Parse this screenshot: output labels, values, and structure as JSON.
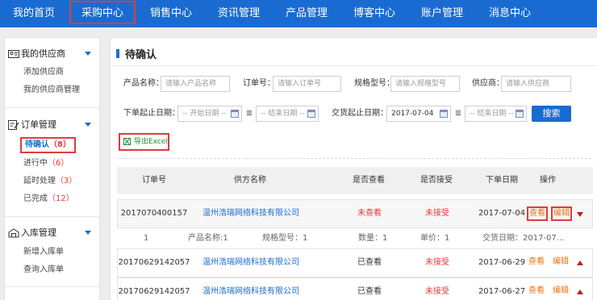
{
  "nav": {
    "items": [
      {
        "label": "我的首页"
      },
      {
        "label": "采购中心"
      },
      {
        "label": "销售中心"
      },
      {
        "label": "资讯管理"
      },
      {
        "label": "产品管理"
      },
      {
        "label": "博客中心"
      },
      {
        "label": "账户管理"
      },
      {
        "label": "消息中心"
      }
    ],
    "active_index": 1
  },
  "sidebar": {
    "suppliers": {
      "title": "我的供应商",
      "items": [
        {
          "label": "添加供应商"
        },
        {
          "label": "我的供应商管理"
        }
      ]
    },
    "orders": {
      "title": "订单管理",
      "items": [
        {
          "label": "待确认",
          "count": "（8）"
        },
        {
          "label": "进行中",
          "count": "（6）"
        },
        {
          "label": "延时处理",
          "count": "（3）"
        },
        {
          "label": "已完成",
          "count": "（12）"
        }
      ]
    },
    "warehouse": {
      "title": "入库管理",
      "items": [
        {
          "label": "新增入库单"
        },
        {
          "label": "查询入库单"
        }
      ]
    }
  },
  "main": {
    "title": "待确认",
    "filters": {
      "product_label": "产品名称：",
      "product_placeholder": "请输入产品名称",
      "order_label": "订单号：",
      "order_placeholder": "请输入订单号",
      "spec_label": "规格型号：",
      "spec_placeholder": "请输入规格型号",
      "supplier_label": "供应商：",
      "supplier_placeholder": "请输入供应商",
      "order_date_label": "下单起止日期：",
      "start_placeholder": "-- 开始日期 --",
      "end_placeholder": "-- 结束日期 --",
      "delivery_date_label": "交货起止日期：",
      "delivery_start_value": "2017-07-04",
      "delivery_end_placeholder": "-- 结束日期 --",
      "sort_icon": "≣",
      "search_label": "搜索"
    },
    "export_label": "导出Excel",
    "table": {
      "headers": [
        "订单号",
        "供方名称",
        "是否查看",
        "是否接受",
        "下单日期",
        "操作"
      ],
      "rows": [
        {
          "order_no": "20170704001​57",
          "supplier": "温州浩瑞网络科技有限公司",
          "viewed": "未查看",
          "accepted": "未接受",
          "date": "2017-07-04",
          "view": "查看",
          "edit": "编辑"
        },
        {
          "order_no": "20170629142057",
          "supplier": "温州浩瑞网络科技有限公司",
          "viewed": "已查看",
          "accepted": "未接受",
          "date": "2017-06-29",
          "view": "查看",
          "edit": "编辑"
        },
        {
          "order_no": "20170629142057",
          "supplier": "温州浩瑞网络科技有限公司",
          "viewed": "已查看",
          "accepted": "未接受",
          "date": "2017-06-27",
          "view": "查看",
          "edit": "编辑"
        }
      ],
      "detail": {
        "index": "1",
        "product": "产品名称:1",
        "spec": "规格型号：1",
        "qty": "数量：1",
        "unit": "单价：1",
        "delivery": "交货日期：2017-07..."
      }
    }
  }
}
